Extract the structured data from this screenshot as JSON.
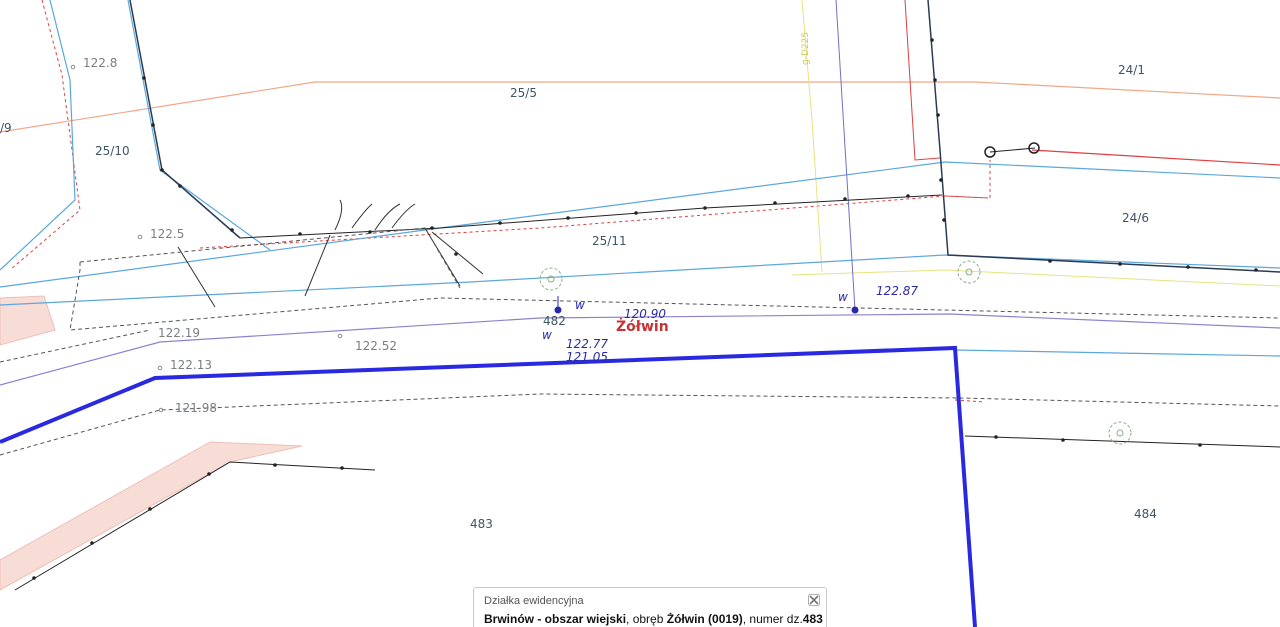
{
  "map": {
    "parcels": [
      "25/5",
      "25/10",
      "25/11",
      "24/1",
      "24/6",
      "482",
      "483",
      "484",
      "/9"
    ],
    "heights": [
      "122.8",
      "122.5",
      "122.19",
      "122.52",
      "122.13",
      "121.98"
    ],
    "utility_labels": [
      "120.90",
      "122.77",
      "121.05",
      "122.87",
      "w",
      "w",
      "w"
    ],
    "place_name": "Żółwin",
    "yellow_label": "g-D225"
  },
  "colors": {
    "boundary_highlight": "#2929e0",
    "parcel_line": "#5aa8dc",
    "orange_line": "#f0a888",
    "red_line": "#e04040",
    "yellow_line": "#e4e480",
    "purple_line": "#9080d0",
    "utility": "#2a2aa8",
    "tree": "#88b088",
    "building_fill": "#f8dcd6"
  },
  "popup": {
    "title": "Działka ewidencyjna",
    "area": "Brwinów - obszar wiejski",
    "sep1": ", obręb ",
    "precinct": "Żółwin (0019)",
    "sep2": ", numer dz.",
    "number": "483",
    "close_icon": "close-icon"
  }
}
